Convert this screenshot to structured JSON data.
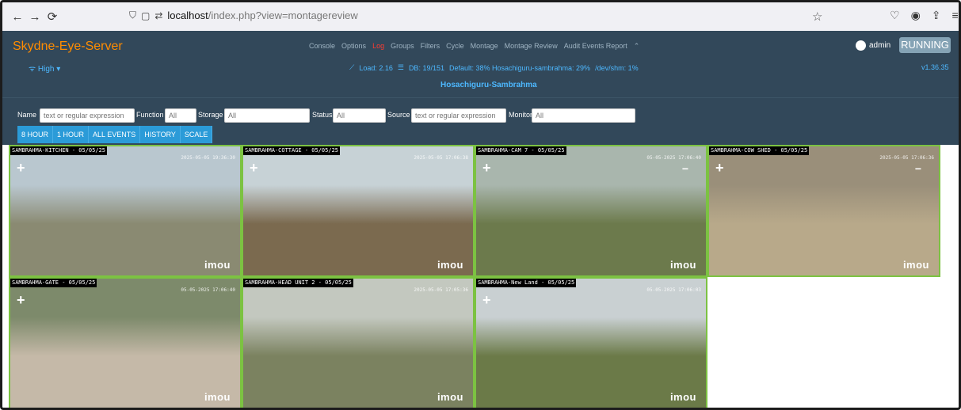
{
  "browser": {
    "url_host": "localhost",
    "url_path": "/index.php?view=montagereview"
  },
  "header": {
    "brand": "Skydne-Eye-Server",
    "bandwidth": "High",
    "nav": [
      "Console",
      "Options",
      "Log",
      "Groups",
      "Filters",
      "Cycle",
      "Montage",
      "Montage Review",
      "Audit Events Report"
    ],
    "active_nav": "Log",
    "user": "admin",
    "state": "RUNNING",
    "load": "Load: 2.16",
    "db": "DB: 19/151",
    "storage": "Default: 38% Hosachiguru-sambrahma: 29%",
    "shm": "/dev/shm: 1%",
    "version": "v1.36.35",
    "montage_title": "Hosachiguru-Sambrahma"
  },
  "filters": {
    "name_label": "Name",
    "name_placeholder": "text or regular expression",
    "function_label": "Function",
    "function_value": "All",
    "storage_label": "Storage",
    "storage_value": "All",
    "status_label": "Status",
    "status_value": "All",
    "source_label": "Source",
    "source_placeholder": "text or regular expression",
    "monitor_label": "Monitor",
    "monitor_value": "All",
    "buttons": [
      "8 HOUR",
      "1 HOUR",
      "ALL EVENTS",
      "HISTORY",
      "SCALE"
    ]
  },
  "cameras": [
    {
      "label": "SAMBRAHMA-KITCHEN - 05/05/25",
      "time": "2025-05-05 19:36:30",
      "brand": "imou",
      "sky": "#b9c7cf",
      "ground": "#8a8a72"
    },
    {
      "label": "SAMBRAHMA-COTTAGE - 05/05/25",
      "time": "2025-05-05 17:06:38",
      "brand": "imou",
      "sky": "#c7d2d6",
      "ground": "#7b6a4f"
    },
    {
      "label": "SAMBRAHMA-CAM 7 - 05/05/25",
      "time": "05-05-2025 17:06:40",
      "brand": "imou",
      "sky": "#a9b6ad",
      "ground": "#6c7a4c"
    },
    {
      "label": "SAMBRAHMA-COW SHED - 05/05/25",
      "time": "2025-05-05 17:06:36",
      "brand": "imou",
      "sky": "#9a8f7a",
      "ground": "#b8a98a"
    },
    {
      "label": "SAMBRAHMA-GATE - 05/05/25",
      "time": "05-05-2025 17:06:40",
      "brand": "imou",
      "sky": "#7d8a6b",
      "ground": "#c5b9a8"
    },
    {
      "label": "SAMBRAHMA-HEAD UNIT 2 - 05/05/25",
      "time": "2025-05-05 17:05:36",
      "brand": "imou",
      "sky": "#c3c8bf",
      "ground": "#7b8260"
    },
    {
      "label": "SAMBRAHMA-New Land - 05/05/25",
      "time": "05-05-2025 17:06:03",
      "brand": "imou",
      "sky": "#c9d0d2",
      "ground": "#6b7a48"
    }
  ]
}
